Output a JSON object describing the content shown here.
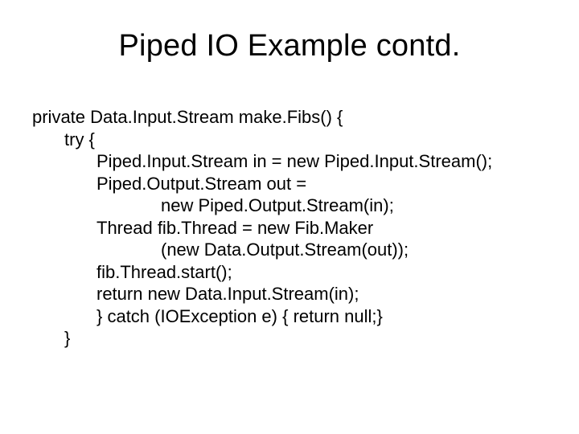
{
  "title": "Piped IO Example contd.",
  "code": {
    "l1": "private Data.Input.Stream make.Fibs() {",
    "l2": "try {",
    "l3": "Piped.Input.Stream in = new Piped.Input.Stream();",
    "l4": "Piped.Output.Stream out =",
    "l5": "new Piped.Output.Stream(in);",
    "l6": "Thread fib.Thread = new Fib.Maker",
    "l7": "(new Data.Output.Stream(out));",
    "l8": "fib.Thread.start();",
    "l9": "return new Data.Input.Stream(in);",
    "l10": "} catch (IOException e) { return null;}",
    "l11": "}"
  }
}
